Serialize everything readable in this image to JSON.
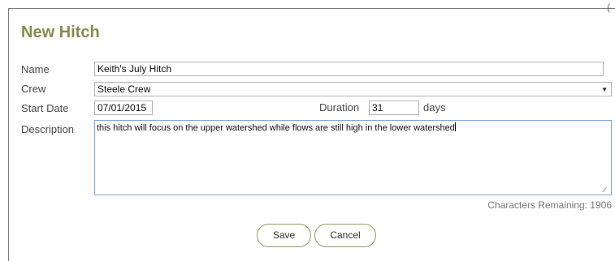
{
  "dialog": {
    "title": "New Hitch",
    "close_glyph": "(",
    "accent_color": "#8a8a50"
  },
  "form": {
    "name": {
      "label": "Name",
      "value": "Keith's July Hitch"
    },
    "crew": {
      "label": "Crew",
      "selected": "Steele Crew"
    },
    "start_date": {
      "label": "Start Date",
      "value": "07/01/2015"
    },
    "duration": {
      "label": "Duration",
      "value": "31",
      "unit": "days"
    },
    "description": {
      "label": "Description",
      "value": "this hitch will focus on the upper watershed while flows are still high in the lower watershed"
    },
    "chars_remaining": "Characters Remaining: 1906"
  },
  "buttons": {
    "save_label": "Save",
    "cancel_label": "Cancel"
  }
}
